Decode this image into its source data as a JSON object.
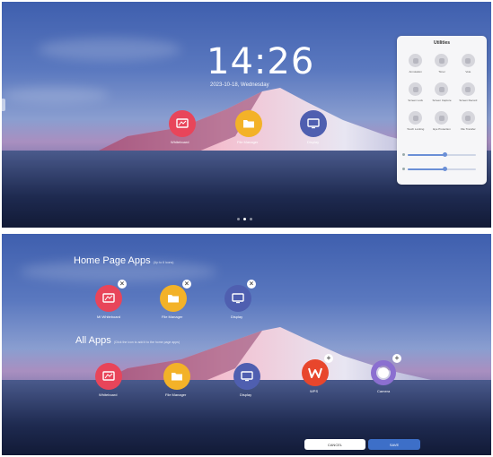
{
  "top_screen": {
    "clock": "14:26",
    "date": "2023-10-18, Wednesday",
    "apps": [
      {
        "label": "Whiteboard",
        "icon": "whiteboard-icon",
        "color": "#e8455a"
      },
      {
        "label": "File Manager",
        "icon": "folder-icon",
        "color": "#f3b228"
      },
      {
        "label": "Display",
        "icon": "display-icon",
        "color": "#4f5fb0"
      }
    ],
    "utilities": {
      "title": "Utilities",
      "items": [
        {
          "label": "Annotation"
        },
        {
          "label": "Timer"
        },
        {
          "label": "Vote"
        },
        {
          "label": "Screen Lock"
        },
        {
          "label": "Screen Capture"
        },
        {
          "label": "Screen Record"
        },
        {
          "label": "Touch Locking"
        },
        {
          "label": "Eye Protection"
        },
        {
          "label": "File Transfer"
        }
      ],
      "sliders": [
        {
          "name": "brightness",
          "value": 0.55
        },
        {
          "name": "volume",
          "value": 0.55
        }
      ]
    },
    "pager": {
      "pages": 3,
      "active": 1
    }
  },
  "bottom_screen": {
    "home_title": "Home Page Apps",
    "home_hint": "(Up to 6 icons)",
    "home_apps": [
      {
        "label": "MI Whiteboard",
        "icon": "whiteboard-icon",
        "color": "#e8455a",
        "badge": "×"
      },
      {
        "label": "File Manager",
        "icon": "folder-icon",
        "color": "#f3b228",
        "badge": "×"
      },
      {
        "label": "Display",
        "icon": "display-icon",
        "color": "#4f5fb0",
        "badge": "×"
      }
    ],
    "all_title": "All Apps",
    "all_hint": "(Click the icon to add it to the home page apps)",
    "all_apps": [
      {
        "label": "Whiteboard",
        "icon": "whiteboard-icon",
        "color": "#e8455a"
      },
      {
        "label": "File Manager",
        "icon": "folder-icon",
        "color": "#f3b228"
      },
      {
        "label": "Display",
        "icon": "display-icon",
        "color": "#4f5fb0"
      },
      {
        "label": "WPS",
        "icon": "wps-icon",
        "color": "#e8462c",
        "badge": "+"
      },
      {
        "label": "Camera",
        "icon": "ring-icon",
        "color": "#8b6fd0",
        "badge": "+"
      }
    ],
    "cancel_label": "CANCEL",
    "save_label": "SAVE"
  }
}
